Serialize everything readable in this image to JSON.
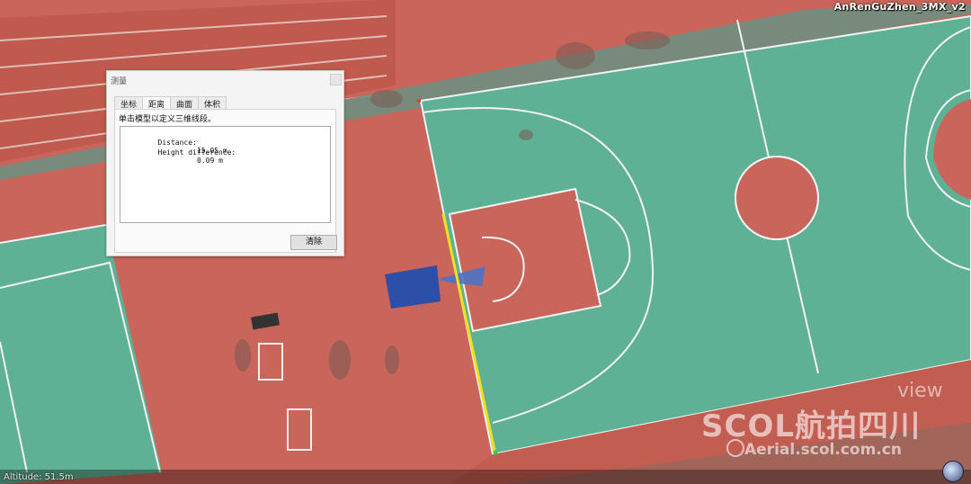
{
  "viewer": {
    "model_name": "AnRenGuZhen_3MX_v2",
    "altitude": "Altitude: 51.5m"
  },
  "watermark": {
    "view": "view",
    "brand": "SCOL航拍四川",
    "url": "Aerial.scol.com.cn"
  },
  "dialog": {
    "title": "测量",
    "tabs": [
      {
        "label": "坐标",
        "active": false
      },
      {
        "label": "距离",
        "active": true
      },
      {
        "label": "曲面",
        "active": false
      },
      {
        "label": "体积",
        "active": false
      }
    ],
    "instruction": "单击模型以定义三维线段。",
    "result": {
      "distance_label": "Distance:",
      "distance_value": "15.05 m",
      "height_label": "Height difference:",
      "height_value": "0.09 m"
    },
    "clear_label": "清除"
  },
  "colors": {
    "court_green": "#5fb196",
    "court_red": "#c9655a",
    "line_white": "#f2f2f2",
    "measure_line": "#f0e01e"
  }
}
